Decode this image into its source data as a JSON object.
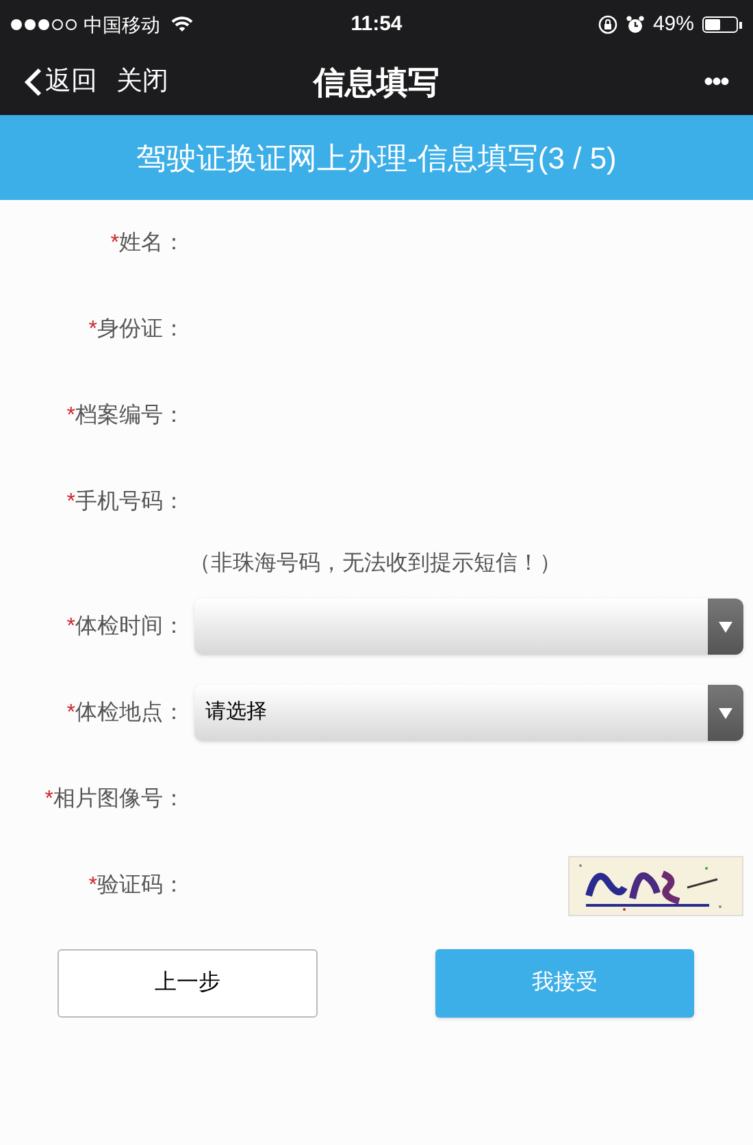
{
  "status_bar": {
    "carrier": "中国移动",
    "time": "11:54",
    "battery": "49%"
  },
  "nav_bar": {
    "back": "返回",
    "close": "关闭",
    "title": "信息填写",
    "more": "•••"
  },
  "banner": {
    "title": "驾驶证换证网上办理-信息填写(3 / 5)"
  },
  "form": {
    "rows": [
      {
        "kind": "text",
        "mark": "*",
        "label": "姓名："
      },
      {
        "kind": "text",
        "mark": "*",
        "label": "身份证："
      },
      {
        "kind": "text",
        "mark": "*",
        "label": "档案编号："
      },
      {
        "kind": "text",
        "mark": "*",
        "label": "手机号码："
      },
      {
        "kind": "note",
        "text": "（非珠海号码，无法收到提示短信！）"
      },
      {
        "kind": "select",
        "mark": "*",
        "label": "体检时间："
      },
      {
        "kind": "select",
        "mark": "*",
        "label": "体检地点：",
        "value": "请选择"
      },
      {
        "kind": "text",
        "mark": "*",
        "label": "相片图像号："
      },
      {
        "kind": "captcha",
        "mark": "*",
        "label": "验证码："
      }
    ]
  },
  "buttons": [
    {
      "label": "上一步",
      "primary": false
    },
    {
      "label": "我接受",
      "primary": true
    }
  ]
}
